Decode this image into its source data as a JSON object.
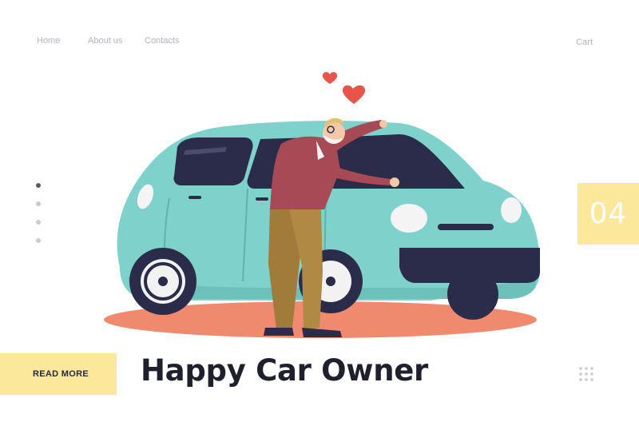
{
  "nav": {
    "items": [
      {
        "label": "Home"
      },
      {
        "label": "About us"
      },
      {
        "label": "Contacts"
      }
    ],
    "cart_label": "Cart"
  },
  "pager": {
    "dots": 4,
    "active_index": 0
  },
  "slide_number": "04",
  "hero": {
    "headline": "Happy Car Owner",
    "cta_label": "READ MORE"
  },
  "icons": {
    "menu": "grid-dots-icon",
    "hearts": "heart-icon"
  },
  "colors": {
    "accent_yellow": "#fbe89a",
    "car_teal": "#7fd2cb",
    "shadow_coral": "#ef8a6e",
    "heart_red": "#e8544a",
    "text_dark": "#1f1f2e",
    "nav_gray": "#b3b3bd"
  }
}
